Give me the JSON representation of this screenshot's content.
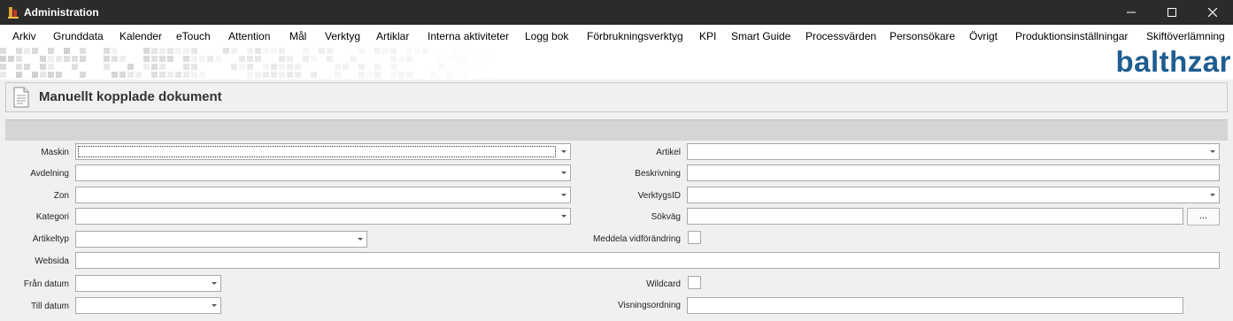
{
  "window": {
    "title": "Administration",
    "icon": "balthzar-app-icon",
    "controls": [
      "minimize-icon",
      "maximize-icon",
      "close-icon"
    ]
  },
  "menu": {
    "items": [
      "Arkiv",
      "Grunddata",
      "Kalender",
      "eTouch",
      "Attention",
      "Mål",
      "Verktyg",
      "Artiklar",
      "Interna aktiviteter",
      "Logg bok",
      "Förbrukningsverktyg",
      "KPI",
      "Smart Guide",
      "Processvärden",
      "Personsökare",
      "Övrigt",
      "Produktionsinställningar",
      "Skiftöverlämning"
    ]
  },
  "brand": {
    "logo_text": "balthzar",
    "color": "#1e5d8f"
  },
  "page": {
    "title": "Manuellt kopplade dokument",
    "icon": "document-icon"
  },
  "form": {
    "left": {
      "maskin": {
        "label": "Maskin",
        "value": ""
      },
      "avdelning": {
        "label": "Avdelning",
        "value": ""
      },
      "zon": {
        "label": "Zon",
        "value": ""
      },
      "kategori": {
        "label": "Kategori",
        "value": ""
      },
      "artikeltyp": {
        "label": "Artikeltyp",
        "value": ""
      },
      "websida": {
        "label": "Websida",
        "value": ""
      },
      "fran_datum": {
        "label": "Från datum",
        "value": ""
      },
      "till_datum": {
        "label": "Till datum",
        "value": ""
      }
    },
    "right": {
      "artikel": {
        "label": "Artikel",
        "value": ""
      },
      "beskrivning": {
        "label": "Beskrivning",
        "value": ""
      },
      "verktygsid": {
        "label": "VerktygsID",
        "value": ""
      },
      "sokvag": {
        "label": "Sökväg",
        "value": "",
        "browse_label": "..."
      },
      "meddela": {
        "label": "Meddela vidförändring",
        "checked": false
      },
      "wildcard": {
        "label": "Wildcard",
        "checked": false
      },
      "visningsordning": {
        "label": "Visningsordning",
        "value": ""
      }
    }
  }
}
